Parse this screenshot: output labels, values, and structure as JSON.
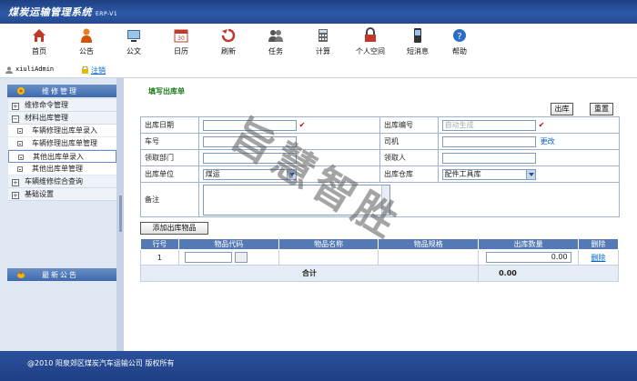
{
  "header": {
    "title": "煤炭运输管理系统",
    "version": "ERP-V1"
  },
  "nav": [
    {
      "label": "首页",
      "icon": "home-icon"
    },
    {
      "label": "公告",
      "icon": "announcement-icon"
    },
    {
      "label": "公文",
      "icon": "document-icon"
    },
    {
      "label": "日历",
      "icon": "calendar-icon"
    },
    {
      "label": "刷新",
      "icon": "refresh-icon"
    },
    {
      "label": "任务",
      "icon": "task-icon"
    },
    {
      "label": "计算",
      "icon": "calculator-icon"
    },
    {
      "label": "个人空间",
      "icon": "lock-icon"
    },
    {
      "label": "短消息",
      "icon": "phone-icon"
    },
    {
      "label": "帮助",
      "icon": "help-icon"
    }
  ],
  "user": {
    "name": "xiuliAdmin",
    "logout": "注销"
  },
  "sidebar": {
    "title": "维修管理",
    "items": [
      {
        "label": "维修命令管理"
      },
      {
        "label": "材料出库管理"
      },
      {
        "label": "车辆修理出库单录入"
      },
      {
        "label": "车辆修理出库单管理"
      },
      {
        "label": "其他出库单录入"
      },
      {
        "label": "其他出库单管理"
      },
      {
        "label": "车辆维修综合查询"
      },
      {
        "label": "基础设置"
      }
    ],
    "notice_title": "最新公告"
  },
  "form": {
    "title": "填写出库单",
    "btn_out": "出库",
    "btn_reset": "重置",
    "out_date_label": "出库日期",
    "out_no_label": "出库编号",
    "out_no_placeholder": "自动生成",
    "check_mark": "✔",
    "vehicle_label": "车号",
    "driver_label": "司机",
    "change_link": "更改",
    "dept_label": "领取部门",
    "receiver_label": "领取人",
    "unit_label": "出库单位",
    "unit_value": "煤运",
    "warehouse_label": "出库仓库",
    "warehouse_value": "配件工具库",
    "remark_label": "备注",
    "add_btn": "添加出库物品"
  },
  "table": {
    "headers": [
      "行号",
      "物品代码",
      "物品名称",
      "物品规格",
      "出库数量",
      "删除"
    ],
    "row": {
      "no": "1",
      "qty": "0.00",
      "delete": "删除"
    },
    "sum_label": "合计",
    "sum_value": "0.00"
  },
  "watermark": "旨慧智胜",
  "footer": {
    "text": "@2010  阳泉郊区煤炭汽车运输公司    版权所有"
  },
  "colors": {
    "header": "#24488f",
    "accent": "#5479b4",
    "title_green": "#1a7a1a",
    "check_red": "#cc0000",
    "link": "#0066cc"
  }
}
